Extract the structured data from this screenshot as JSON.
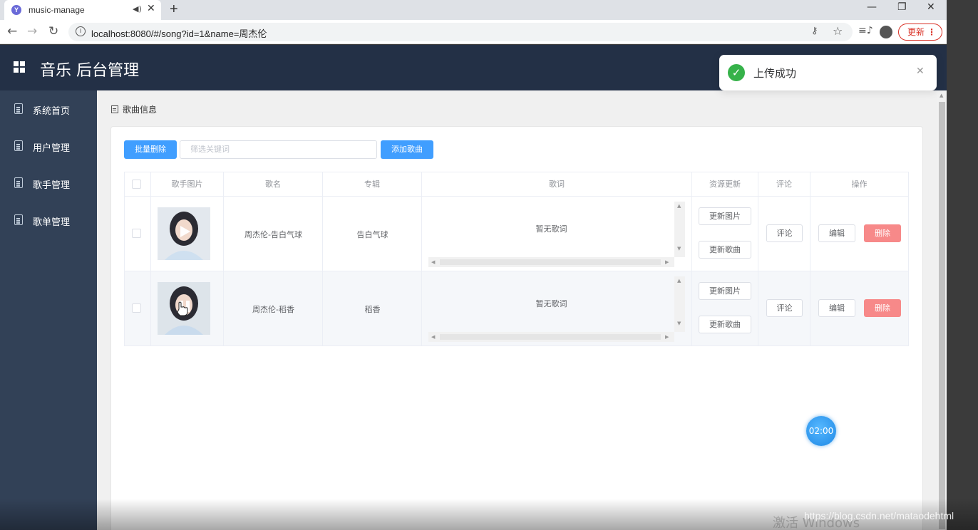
{
  "browser": {
    "tab_title": "music-manage",
    "url": "localhost:8080/#/song?id=1&name=周杰伦",
    "update_label": "更新"
  },
  "app": {
    "title": "音乐 后台管理"
  },
  "sidebar": {
    "items": [
      {
        "label": "系统首页"
      },
      {
        "label": "用户管理"
      },
      {
        "label": "歌手管理"
      },
      {
        "label": "歌单管理"
      }
    ]
  },
  "breadcrumb": "歌曲信息",
  "toolbar": {
    "batch_delete": "批量删除",
    "search_placeholder": "筛选关键词",
    "add_song": "添加歌曲"
  },
  "table": {
    "headers": [
      "歌手图片",
      "歌名",
      "专辑",
      "歌词",
      "资源更新",
      "评论",
      "操作"
    ],
    "rows": [
      {
        "name": "周杰伦-告白气球",
        "album": "告白气球",
        "lyric": "暂无歌词"
      },
      {
        "name": "周杰伦-稻香",
        "album": "稻香",
        "lyric": "暂无歌词"
      }
    ],
    "btn_update_image": "更新图片",
    "btn_update_song": "更新歌曲",
    "btn_comment": "评论",
    "btn_edit": "编辑",
    "btn_delete": "删除"
  },
  "toast": {
    "message": "上传成功"
  },
  "timer": "02:00",
  "watermark": {
    "activate": "激活 Windows",
    "url": "https://blog.csdn.net/mataodehtml"
  },
  "colors": {
    "header_bg": "#233046",
    "sidebar_bg": "#324157",
    "primary": "#409eff",
    "danger": "#f78989",
    "success": "#36b24a"
  }
}
